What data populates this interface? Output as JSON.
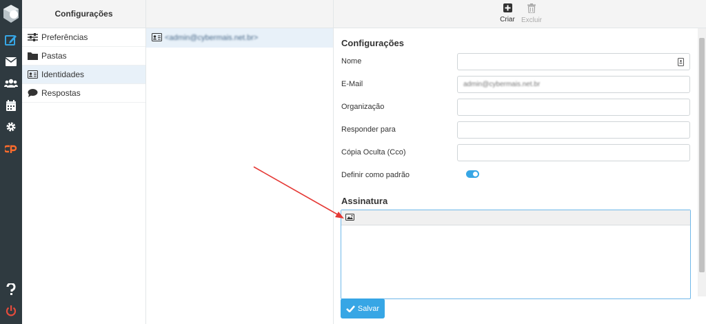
{
  "app": {
    "header_title": "Configurações"
  },
  "nav": {
    "items": [
      {
        "label": "Preferências",
        "icon": "sliders-icon"
      },
      {
        "label": "Pastas",
        "icon": "folder-icon"
      },
      {
        "label": "Identidades",
        "icon": "id-card-icon"
      },
      {
        "label": "Respostas",
        "icon": "comment-icon"
      }
    ],
    "selected": "Identidades"
  },
  "identities": {
    "items": [
      {
        "label": "<admin@cybermais.net.br>"
      }
    ]
  },
  "toolbar": {
    "create_label": "Criar",
    "delete_label": "Excluir"
  },
  "form": {
    "section_title": "Configurações",
    "fields": {
      "name_label": "Nome",
      "email_label": "E-Mail",
      "email_value": "admin@cybermais.net.br",
      "org_label": "Organização",
      "reply_label": "Responder para",
      "bcc_label": "Cópia Oculta (Cco)",
      "default_label": "Definir como padrão"
    },
    "default_on": true
  },
  "signature": {
    "title": "Assinatura"
  },
  "actions": {
    "save_label": "Salvar"
  },
  "colors": {
    "rail": "#2f3a40",
    "accent": "#37a6e5",
    "selected": "#e8f1f9",
    "arrow": "#e53935",
    "logout": "#e74c3c",
    "cpanel": "#ff6c2c"
  }
}
